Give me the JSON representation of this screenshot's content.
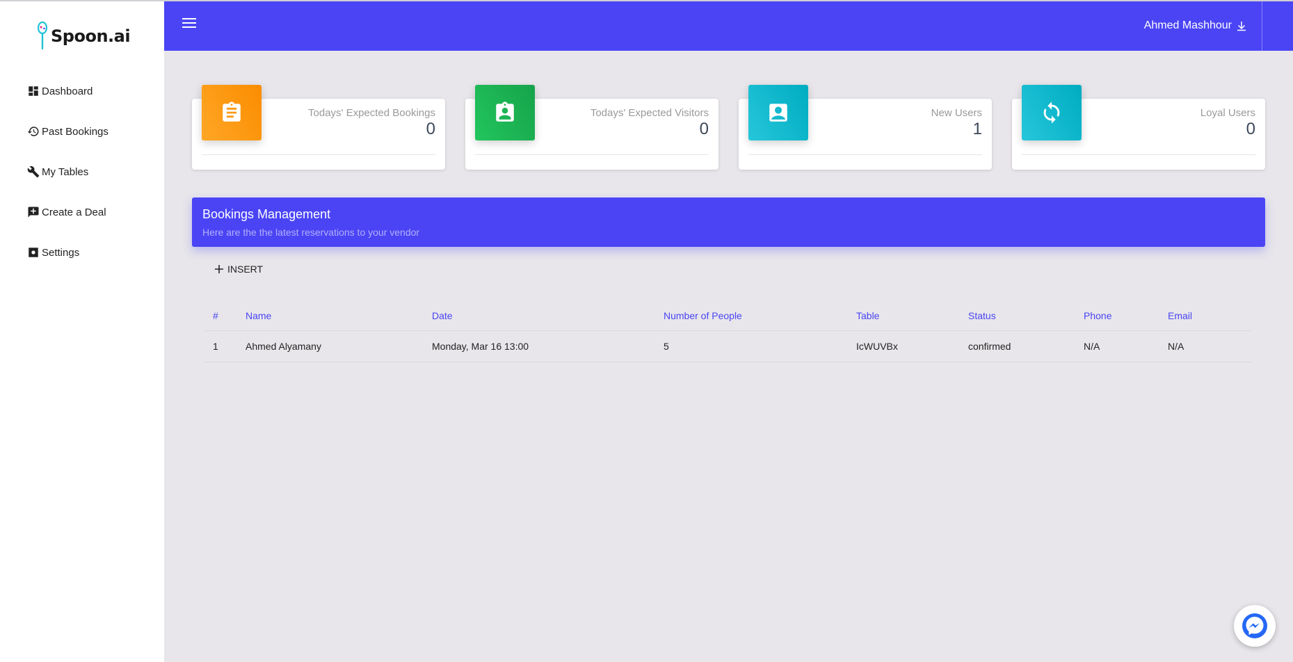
{
  "app": {
    "logo_text": "Spoon.ai"
  },
  "sidebar": {
    "items": [
      {
        "label": "Dashboard",
        "icon": "dashboard-icon"
      },
      {
        "label": "Past Bookings",
        "icon": "history-icon"
      },
      {
        "label": "My Tables",
        "icon": "wrench-icon"
      },
      {
        "label": "Create a Deal",
        "icon": "add-comment-icon"
      },
      {
        "label": "Settings",
        "icon": "settings-icon"
      }
    ]
  },
  "header": {
    "user_name": "Ahmed Mashhour",
    "menu_icon": "hamburger-icon",
    "user_icon": "download-arrow-icon"
  },
  "cards": [
    {
      "label": "Todays' Expected Bookings",
      "value": "0",
      "icon": "clipboard-icon",
      "color": "#fb8c00"
    },
    {
      "label": "Todays' Expected Visitors",
      "value": "0",
      "icon": "badge-icon",
      "color": "#16a34a"
    },
    {
      "label": "New Users",
      "value": "1",
      "icon": "contact-icon",
      "color": "#00acc1"
    },
    {
      "label": "Loyal Users",
      "value": "0",
      "icon": "refresh-icon",
      "color": "#00acc1"
    }
  ],
  "bookings": {
    "title": "Bookings Management",
    "subtitle": "Here are the the latest reservations to your vendor",
    "insert_label": "INSERT",
    "columns": [
      "#",
      "Name",
      "Date",
      "Number of People",
      "Table",
      "Status",
      "Phone",
      "Email"
    ],
    "rows": [
      [
        "1",
        "Ahmed Alyamany",
        "Monday, Mar 16 13:00",
        "5",
        "IcWUVBx",
        "confirmed",
        "N/A",
        "N/A"
      ]
    ]
  },
  "colors": {
    "primary": "#4a44f5",
    "background": "#e8e6ea"
  }
}
